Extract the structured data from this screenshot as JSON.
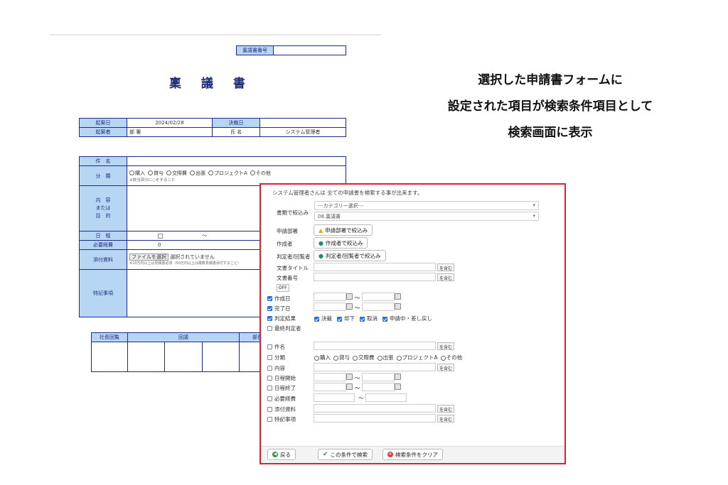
{
  "form": {
    "ringi_no_label": "稟議書番号",
    "title": "稟 議 書",
    "kian_date_label": "起案日",
    "kian_date": "2024/02/28",
    "kessai_date_label": "決裁日",
    "kianja_label": "起案者",
    "busho_label": "部 署",
    "shimei_label": "氏 名",
    "user_name": "システム管理者",
    "kenmei_label": "件　名",
    "bunrui_label": "分　類",
    "bunrui_options": [
      "購入",
      "貸与",
      "交際費",
      "出張",
      "プロジェクトA",
      "その他"
    ],
    "bunrui_note": "※該当部分に○をすること",
    "naiyou_label": "内　容\nまたは\n目　的",
    "nittei_label": "日　程",
    "nittei_sep": "～",
    "keihi_label": "必要経費",
    "keihi_value": "0",
    "tenpu_label": "添付資料",
    "file_button": "ファイルを選択",
    "file_status": "選択されていません",
    "tenpu_note": "※10万円以上は見積書必須（50万円以上は複数見積書添付すること）",
    "tokki_label": "特記事項",
    "approval_headers": [
      "社長回覧",
      "回議",
      "",
      "部長"
    ]
  },
  "caption": {
    "line1": "選択した申請書フォームに",
    "line2": "設定された項目が検索条件項目として",
    "line3": "検索画面に表示"
  },
  "search": {
    "intro": "システム管理者さんは 全ての申請書を検索する事が出来ます。",
    "filter_label": "書類で絞込み",
    "category_placeholder": "---カテゴリー選択---",
    "form_selected": "08.稟議書",
    "dept_label": "申請部署",
    "dept_button": "申請部署で絞込み",
    "author_label": "作成者",
    "author_button": "作成者で絞込み",
    "judge_label": "判定者/回覧者",
    "judge_button": "判定者/回覧者で絞込み",
    "doc_title_label": "文書タイトル",
    "doc_no_label": "文書番号",
    "contains": "を含む",
    "off_label": "OFF",
    "created_label": "作成日",
    "completed_label": "完了日",
    "range_sep": "～",
    "result_label": "判定結果",
    "result_options": [
      "決裁",
      "却下",
      "取消",
      "申請中・差し戻し"
    ],
    "last_judge_label": "最終判定者",
    "item_kenmei": "件名",
    "item_bunrui": "分類",
    "item_bunrui_options": [
      "購入",
      "貸与",
      "交際費",
      "出張",
      "プロジェクトA",
      "その他"
    ],
    "item_naiyou": "内容",
    "item_start": "日程開始",
    "item_end": "日程終了",
    "item_cost": "必要経費",
    "item_attach": "添付資料",
    "item_notes": "特記事項",
    "back_button": "戻る",
    "search_button": "この条件で検索",
    "clear_button": "検索条件をクリア"
  }
}
